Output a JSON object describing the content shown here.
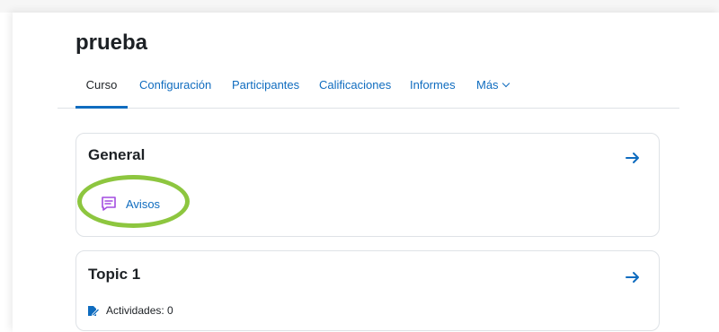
{
  "course": {
    "title": "prueba"
  },
  "nav": {
    "tabs": [
      {
        "label": "Curso",
        "active": true
      },
      {
        "label": "Configuración"
      },
      {
        "label": "Participantes"
      },
      {
        "label": "Calificaciones"
      },
      {
        "label": "Informes"
      },
      {
        "label": "Más"
      }
    ]
  },
  "sections": [
    {
      "title": "General",
      "activities": [
        {
          "label": "Avisos",
          "icon": "forum-icon",
          "icon_color": "#a34ce0"
        }
      ]
    },
    {
      "title": "Topic 1",
      "activity_count": "Actividades: 0"
    }
  ],
  "colors": {
    "link": "#0f6cbf",
    "highlight_ring": "#8dc63f",
    "forum_icon": "#a34ce0"
  }
}
